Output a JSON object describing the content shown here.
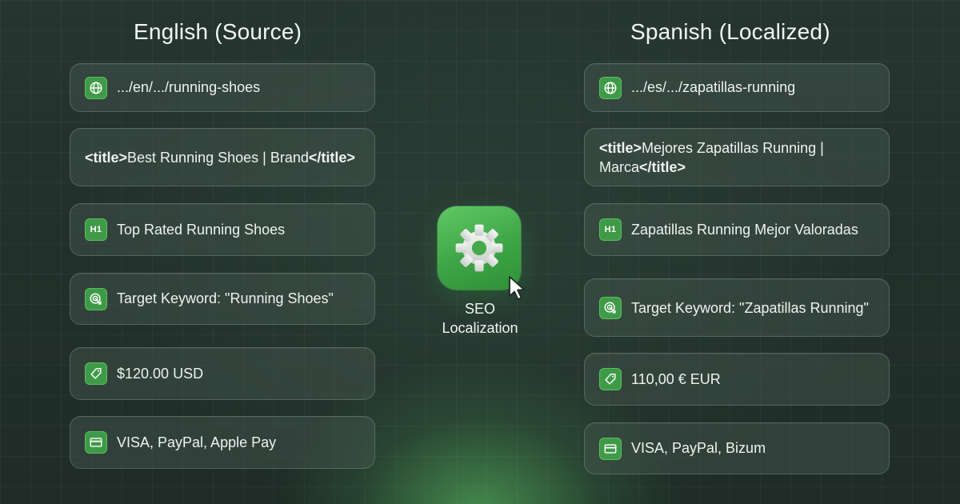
{
  "left": {
    "title": "English (Source)",
    "url": ".../en/.../running-shoes",
    "title_tag": {
      "open": "<title>",
      "text": "Best Running Shoes | Brand",
      "close": "</title>"
    },
    "h1_badge": "H1",
    "h1": "Top Rated Running Shoes",
    "keyword": "Target Keyword: \"Running Shoes\"",
    "price": "$120.00 USD",
    "payments": "VISA, PayPal, Apple Pay"
  },
  "center": {
    "label_line1": "SEO",
    "label_line2": "Localization"
  },
  "right": {
    "title": "Spanish (Localized)",
    "url": ".../es/.../zapatillas-running",
    "title_tag": {
      "open": "<title>",
      "text": "Mejores Zapatillas Running | Marca",
      "close": "</title>"
    },
    "h1_badge": "H1",
    "h1": "Zapatillas Running Mejor Valoradas",
    "keyword": "Target Keyword: \"Zapatillas Running\"",
    "price": "110,00 € EUR",
    "payments": "VISA, PayPal, Bizum"
  },
  "colors": {
    "accent": "#3f9a48",
    "accent_light": "#5fc862",
    "background": "#22302b"
  },
  "icons": {
    "url": "globe-icon",
    "h1": "heading-icon",
    "keyword": "target-icon",
    "price": "price-tag-icon",
    "payments": "credit-card-icon",
    "center": "gear-icon",
    "pointer": "cursor-icon"
  }
}
